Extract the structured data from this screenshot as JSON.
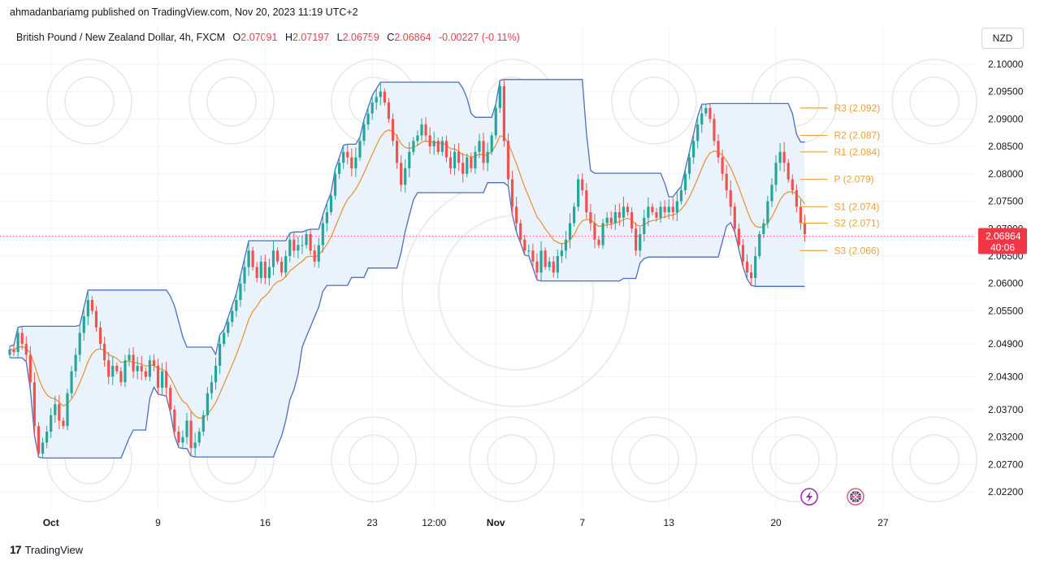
{
  "header": {
    "published": "ahmadanbariamg published on TradingView.com, Nov 20, 2023 11:19 UTC+2"
  },
  "legend": {
    "symbol": "British Pound / New Zealand Dollar, 4h, FXCM",
    "open_label": "O",
    "open": "2.07091",
    "high_label": "H",
    "high": "2.07197",
    "low_label": "L",
    "low": "2.06759",
    "close_label": "C",
    "close": "2.06864",
    "change": "-0.00227 (-0.11%)"
  },
  "currency_button": "NZD",
  "footer": {
    "brand": "TradingView",
    "logo_glyph": "17"
  },
  "colors": {
    "bull": "#26a69a",
    "bear": "#ef5350",
    "channel": "#4a6fc3",
    "channel_fill": "#eaf3fb",
    "midline": "#e8902f",
    "pivot": "#e8a33d",
    "price_tag": "#f23645",
    "grid": "#f0f3fa"
  },
  "chart_data": {
    "type": "candlestick",
    "symbol": "GBPNZD",
    "timeframe": "4h",
    "ylim": [
      2.0195,
      2.1025
    ],
    "y_ticks": [
      "2.10000",
      "2.09500",
      "2.09000",
      "2.08500",
      "2.08000",
      "2.07500",
      "2.07000",
      "2.06500",
      "2.06000",
      "2.05500",
      "2.04900",
      "2.04300",
      "2.03700",
      "2.03200",
      "2.02700",
      "2.02200"
    ],
    "x_ticks": [
      {
        "label": "Oct",
        "i": 10,
        "bold": true
      },
      {
        "label": "9",
        "i": 36,
        "bold": false
      },
      {
        "label": "16",
        "i": 62,
        "bold": false
      },
      {
        "label": "23",
        "i": 88,
        "bold": false
      },
      {
        "label": "12:00",
        "i": 103,
        "bold": false
      },
      {
        "label": "Nov",
        "i": 118,
        "bold": true
      },
      {
        "label": "7",
        "i": 139,
        "bold": false
      },
      {
        "label": "13",
        "i": 160,
        "bold": false
      },
      {
        "label": "20",
        "i": 186,
        "bold": false
      },
      {
        "label": "27",
        "i": 212,
        "bold": false
      }
    ],
    "current_price": {
      "value": 2.06864,
      "label": "2.06864",
      "countdown": "40:06"
    },
    "pivots": [
      {
        "label": "R3 (2.092)",
        "value": 2.092
      },
      {
        "label": "R2 (2.087)",
        "value": 2.087
      },
      {
        "label": "R1 (2.084)",
        "value": 2.084
      },
      {
        "label": "P (2.079)",
        "value": 2.079
      },
      {
        "label": "S1 (2.074)",
        "value": 2.074
      },
      {
        "label": "S2 (2.071)",
        "value": 2.071
      },
      {
        "label": "S3 (2.066)",
        "value": 2.066
      }
    ],
    "close_path": [
      2.048,
      2.0475,
      2.051,
      2.049,
      2.047,
      2.042,
      2.034,
      2.029,
      2.031,
      2.033,
      2.036,
      2.038,
      2.035,
      2.034,
      2.04,
      2.044,
      2.047,
      2.051,
      2.054,
      2.057,
      2.055,
      2.052,
      2.049,
      2.046,
      2.043,
      2.045,
      2.044,
      2.042,
      2.046,
      2.047,
      2.044,
      2.045,
      2.044,
      2.043,
      2.046,
      2.045,
      2.041,
      2.044,
      2.041,
      2.037,
      2.033,
      2.031,
      2.032,
      2.035,
      2.03,
      2.031,
      2.033,
      2.036,
      2.04,
      2.042,
      2.045,
      2.049,
      2.051,
      2.053,
      2.055,
      2.057,
      2.06,
      2.063,
      2.066,
      2.063,
      2.061,
      2.064,
      2.061,
      2.063,
      2.066,
      2.064,
      2.062,
      2.065,
      2.068,
      2.066,
      2.067,
      2.067,
      2.069,
      2.066,
      2.064,
      2.067,
      2.071,
      2.073,
      2.076,
      2.08,
      2.082,
      2.084,
      2.083,
      2.081,
      2.083,
      2.086,
      2.089,
      2.091,
      2.093,
      2.094,
      2.095,
      2.093,
      2.09,
      2.086,
      2.082,
      2.078,
      2.081,
      2.084,
      2.086,
      2.087,
      2.089,
      2.087,
      2.085,
      2.086,
      2.084,
      2.086,
      2.083,
      2.081,
      2.084,
      2.082,
      2.08,
      2.083,
      2.081,
      2.084,
      2.086,
      2.082,
      2.084,
      2.087,
      2.092,
      2.096,
      2.086,
      2.079,
      2.074,
      2.071,
      2.068,
      2.066,
      2.066,
      2.064,
      2.062,
      2.066,
      2.063,
      2.064,
      2.062,
      2.065,
      2.066,
      2.068,
      2.071,
      2.074,
      2.079,
      2.077,
      2.073,
      2.071,
      2.068,
      2.067,
      2.071,
      2.072,
      2.071,
      2.073,
      2.072,
      2.074,
      2.073,
      2.07,
      2.066,
      2.069,
      2.072,
      2.074,
      2.073,
      2.072,
      2.074,
      2.073,
      2.074,
      2.073,
      2.075,
      2.077,
      2.08,
      2.083,
      2.086,
      2.089,
      2.091,
      2.092,
      2.09,
      2.086,
      2.083,
      2.08,
      2.077,
      2.074,
      2.07,
      2.067,
      2.064,
      2.062,
      2.061,
      2.065,
      2.069,
      2.071,
      2.075,
      2.078,
      2.082,
      2.084,
      2.082,
      2.079,
      2.077,
      2.074,
      2.071,
      2.069
    ]
  }
}
